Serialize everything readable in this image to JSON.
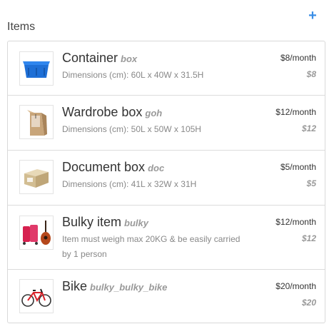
{
  "header": {
    "title": "Items",
    "add_icon": "plus-icon",
    "accent_color": "#3a8ee6"
  },
  "items": [
    {
      "name": "Container",
      "code": "box",
      "description": "Dimensions (cm): 60L x 40W x 31.5H",
      "price_per_month": "$8/month",
      "price": "$8",
      "icon": "blue-container-icon"
    },
    {
      "name": "Wardrobe box",
      "code": "goh",
      "description": "Dimensions (cm): 50L x 50W x 105H",
      "price_per_month": "$12/month",
      "price": "$12",
      "icon": "wardrobe-box-icon"
    },
    {
      "name": "Document box",
      "code": "doc",
      "description": "Dimensions (cm): 41L x 32W x 31H",
      "price_per_month": "$5/month",
      "price": "$5",
      "icon": "document-box-icon"
    },
    {
      "name": "Bulky item",
      "code": "bulky",
      "description": "Item must weigh max 20KG & be easily carried by 1 person",
      "price_per_month": "$12/month",
      "price": "$12",
      "icon": "bulky-items-icon"
    },
    {
      "name": "Bike",
      "code": "bulky_bulky_bike",
      "description": "",
      "price_per_month": "$20/month",
      "price": "$20",
      "icon": "bike-icon"
    }
  ]
}
